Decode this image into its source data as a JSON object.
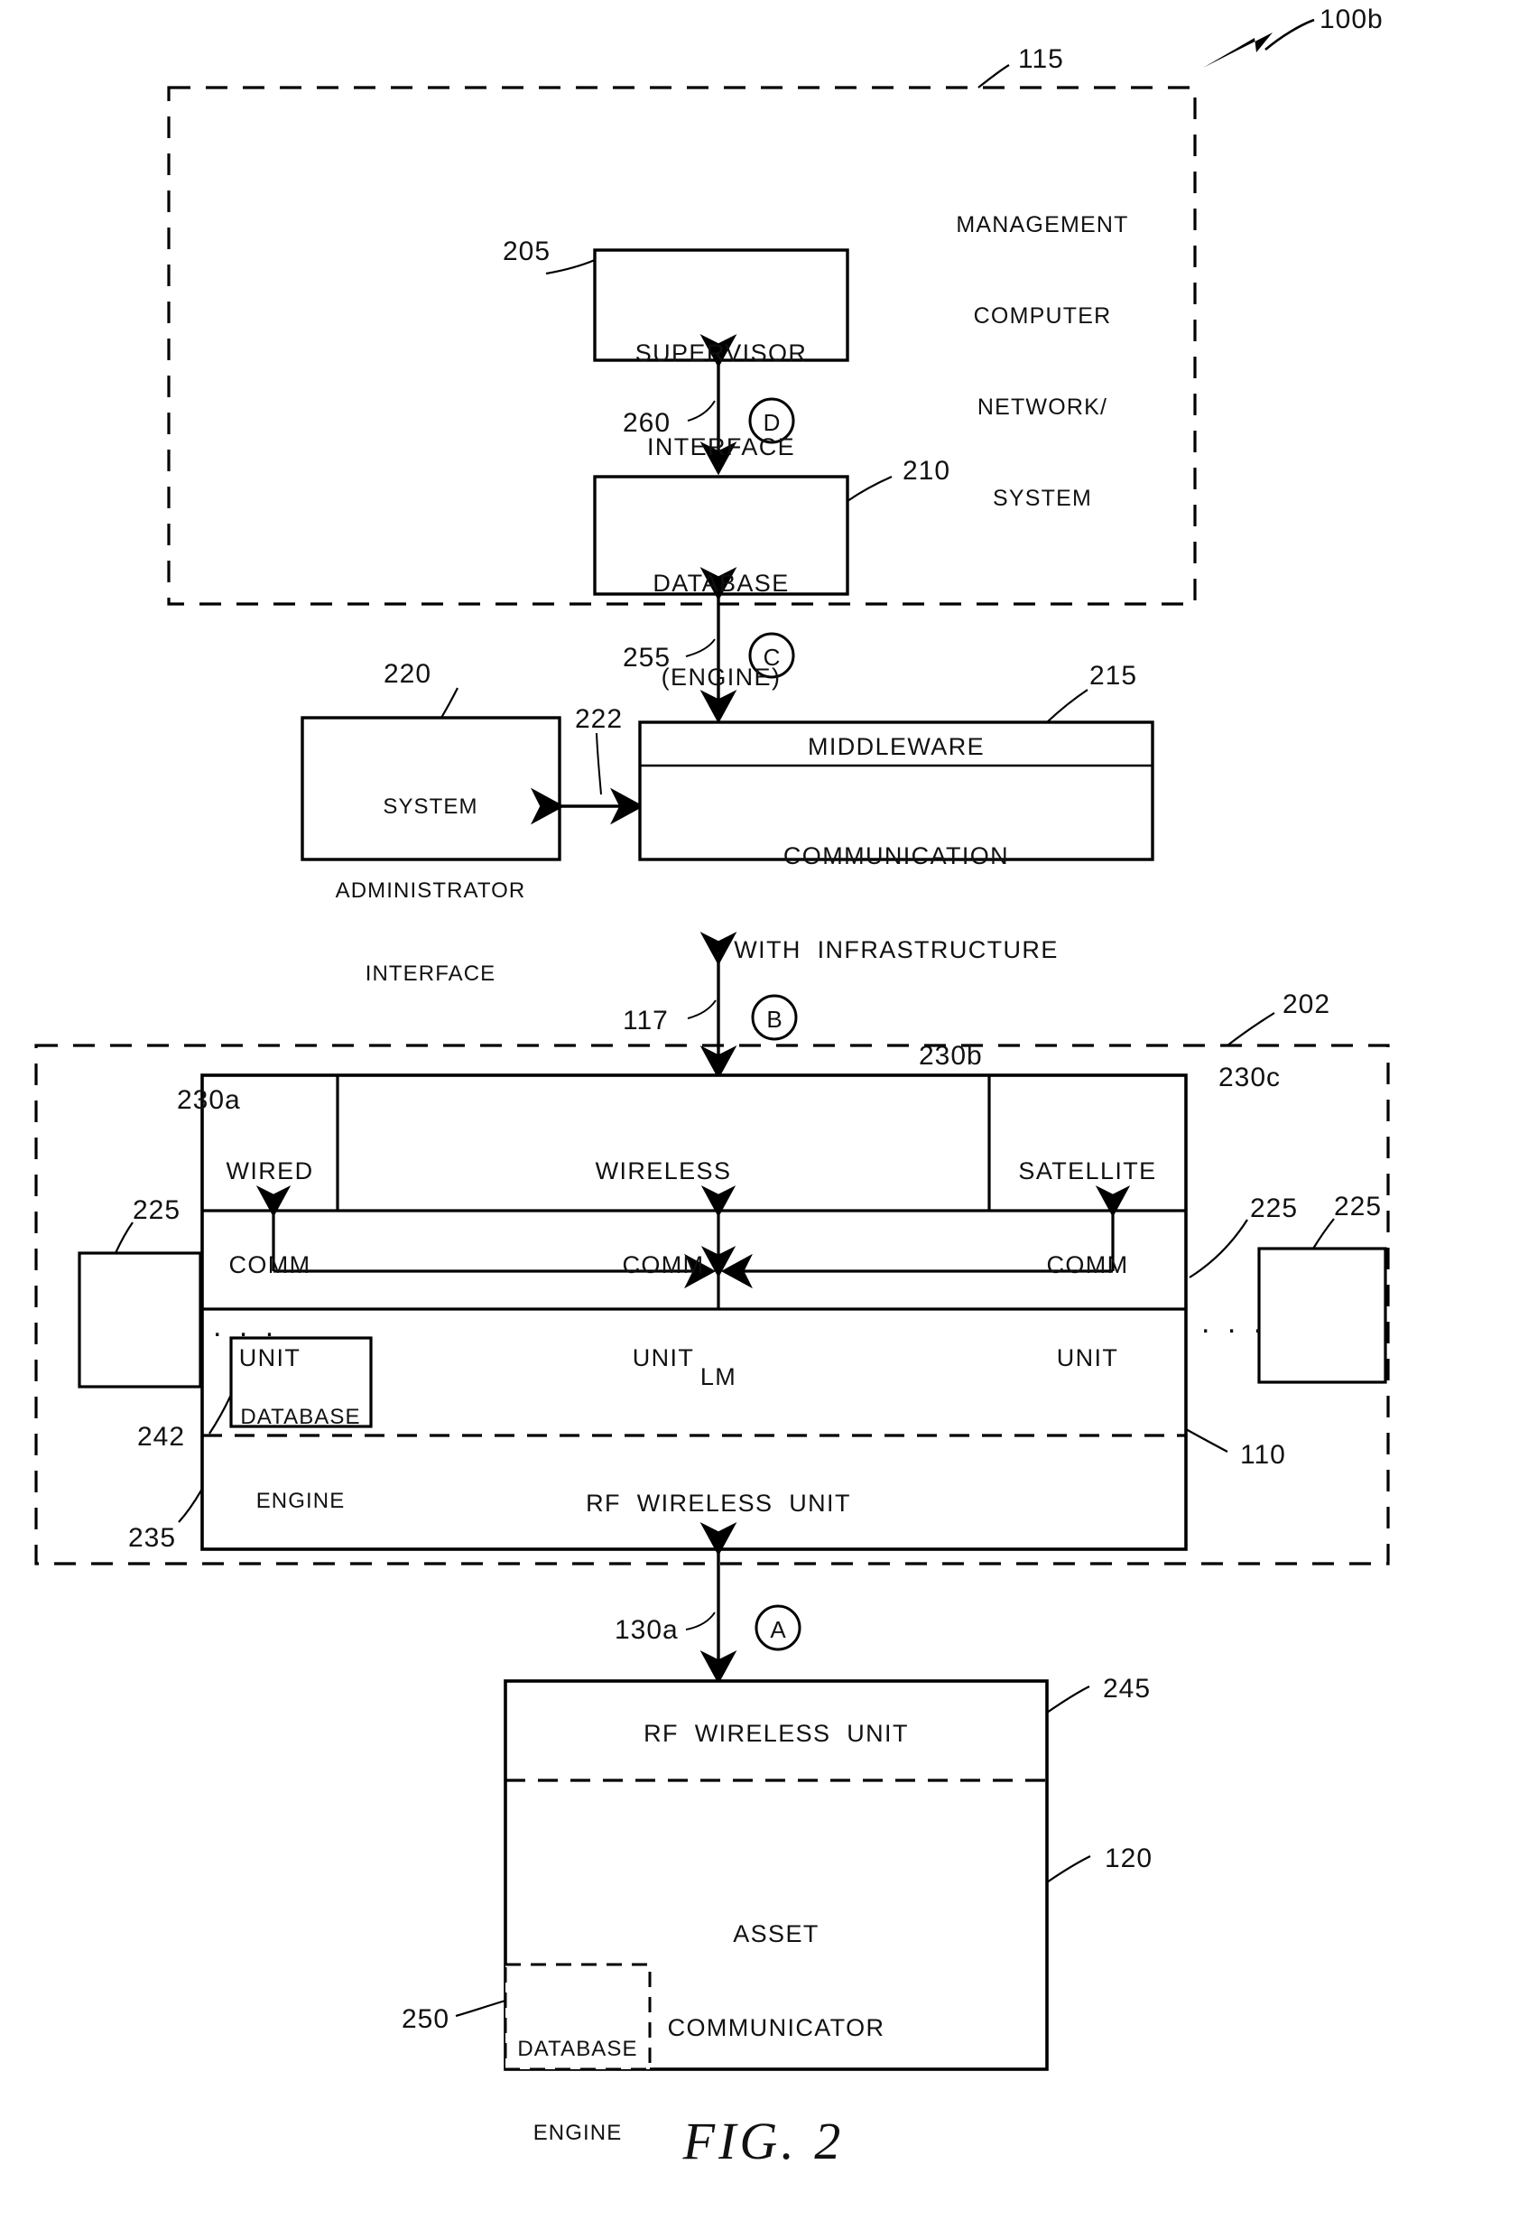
{
  "figure": {
    "caption": "FIG. 2",
    "system_ref": "100b"
  },
  "management_network": {
    "ref": "115",
    "label_lines": [
      "MANAGEMENT",
      "COMPUTER",
      "NETWORK/",
      "SYSTEM"
    ],
    "blocks": [
      {
        "ref": "205",
        "lines": [
          "SUPERVISOR",
          "INTERFACE"
        ],
        "name": "supervisor-interface"
      },
      {
        "ref": "210",
        "lines": [
          "DATABASE",
          "(ENGINE)"
        ],
        "name": "database-engine"
      },
      {
        "ref": "220",
        "lines": [
          "SYSTEM",
          "ADMINISTRATOR",
          "INTERFACE"
        ],
        "name": "system-administrator-interface"
      },
      {
        "ref": "215",
        "lines": [
          "MIDDLEWARE"
        ],
        "sub_lines": [
          "COMMUNICATION",
          "WITH  INFRASTRUCTURE"
        ],
        "name": "middleware"
      }
    ],
    "links": [
      {
        "ref": "260",
        "letter": "D",
        "name": "link-supervisor-database"
      },
      {
        "ref": "255",
        "letter": "C",
        "name": "link-database-middleware"
      },
      {
        "ref": "222",
        "letter": "",
        "name": "link-sysadmin-middleware"
      }
    ]
  },
  "infrastructure": {
    "ref": "202",
    "unit_ref": "110",
    "comm_units": [
      {
        "ref": "230a",
        "lines": [
          "WIRED",
          "COMM",
          "UNIT"
        ],
        "name": "wired-comm-unit"
      },
      {
        "ref": "230b",
        "lines": [
          "WIRELESS",
          "COMM",
          "UNIT"
        ],
        "name": "wireless-comm-unit"
      },
      {
        "ref": "230c",
        "lines": [
          "SATELLITE",
          "COMM",
          "UNIT"
        ],
        "name": "satellite-comm-unit"
      }
    ],
    "lm": {
      "label": "LM",
      "name": "lm-block"
    },
    "db_engine": {
      "ref": "242",
      "lines": [
        "DATABASE",
        "ENGINE"
      ],
      "name": "infrastructure-database-engine"
    },
    "rf_unit": {
      "ref": "235",
      "label": "RF  WIRELESS  UNIT",
      "name": "infrastructure-rf-wireless-unit"
    },
    "peer_ref_left": "225",
    "peer_ref_right_a": "225",
    "peer_ref_right_b": "225",
    "ellipsis": ". . ."
  },
  "uplink": {
    "ref": "117",
    "letter": "B",
    "name": "link-infrastructure-management"
  },
  "downlink": {
    "ref": "130a",
    "letter": "A",
    "name": "link-infrastructure-asset"
  },
  "asset": {
    "ref": "120",
    "rf_unit": {
      "ref": "245",
      "label": "RF  WIRELESS  UNIT",
      "name": "asset-rf-wireless-unit"
    },
    "communicator": {
      "lines": [
        "ASSET",
        "COMMUNICATOR"
      ],
      "name": "asset-communicator"
    },
    "db_engine": {
      "ref": "250",
      "lines": [
        "DATABASE",
        "ENGINE"
      ],
      "name": "asset-database-engine"
    }
  },
  "colors": {
    "ink": "#000000",
    "paper": "#ffffff"
  }
}
